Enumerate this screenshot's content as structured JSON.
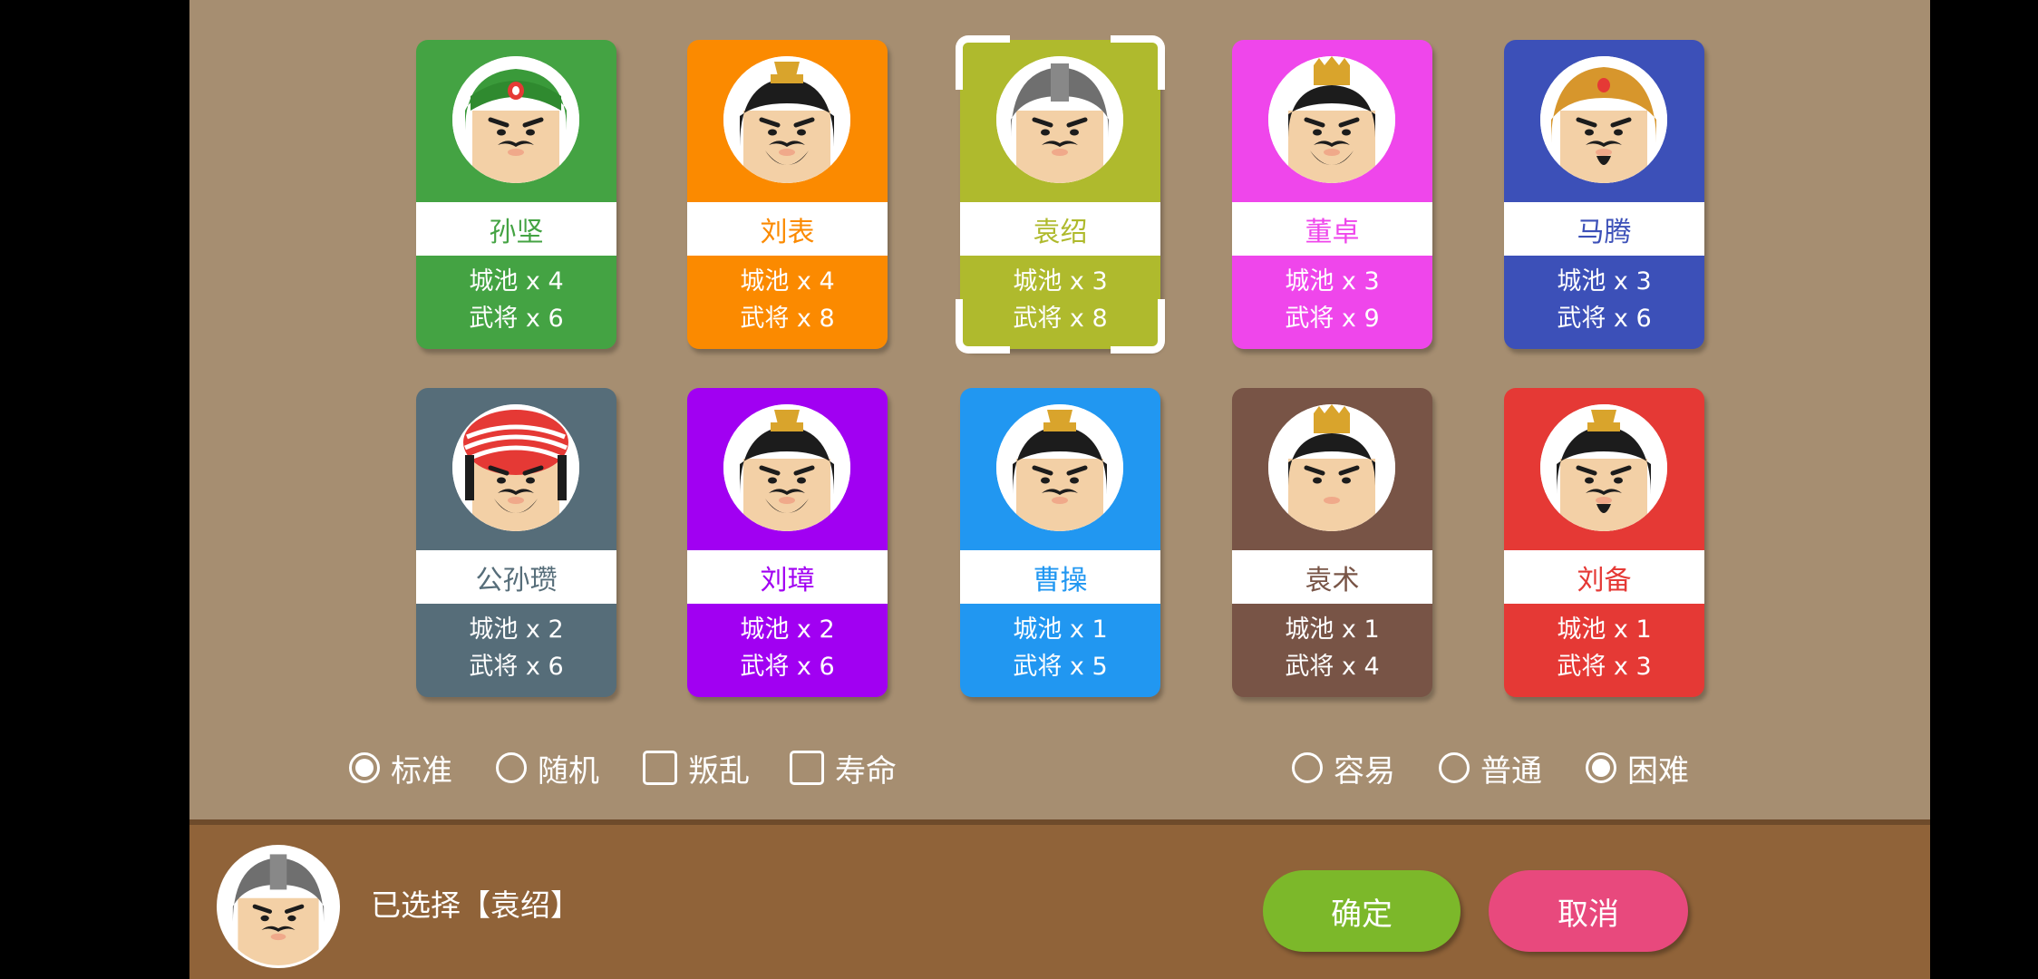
{
  "cards": [
    {
      "name": "孙坚",
      "cities": "城池 x 4",
      "generals": "武将 x 6",
      "color": "#44a343",
      "name_color": "#44a343",
      "icon": "warlord-sun-jian-portrait-icon",
      "headwear": "green-helmet",
      "beard": "mustache"
    },
    {
      "name": "刘表",
      "cities": "城池 x 4",
      "generals": "武将 x 8",
      "color": "#fb8a00",
      "name_color": "#fb8a00",
      "icon": "warlord-liu-biao-portrait-icon",
      "headwear": "black-cap-gold",
      "beard": "full"
    },
    {
      "name": "袁绍",
      "cities": "城池 x 3",
      "generals": "武将 x 8",
      "color": "#afba2d",
      "name_color": "#afba2d",
      "icon": "warlord-yuan-shao-portrait-icon",
      "headwear": "grey-helmet",
      "beard": "mustache"
    },
    {
      "name": "董卓",
      "cities": "城池 x 3",
      "generals": "武将 x 9",
      "color": "#ef46eb",
      "name_color": "#ef46eb",
      "icon": "warlord-dong-zhuo-portrait-icon",
      "headwear": "gold-crown",
      "beard": "full"
    },
    {
      "name": "马腾",
      "cities": "城池 x 3",
      "generals": "武将 x 6",
      "color": "#3c50b8",
      "name_color": "#3c50b8",
      "icon": "warlord-ma-teng-portrait-icon",
      "headwear": "gold-helmet",
      "beard": "goatee"
    },
    {
      "name": "公孙瓒",
      "cities": "城池 x 2",
      "generals": "武将 x 6",
      "color": "#566d79",
      "name_color": "#566d79",
      "icon": "warlord-gongsun-zan-portrait-icon",
      "headwear": "red-turban",
      "beard": "full"
    },
    {
      "name": "刘璋",
      "cities": "城池 x 2",
      "generals": "武将 x 6",
      "color": "#a100f2",
      "name_color": "#a100f2",
      "icon": "warlord-liu-zhang-portrait-icon",
      "headwear": "black-cap-gold",
      "beard": "full"
    },
    {
      "name": "曹操",
      "cities": "城池 x 1",
      "generals": "武将 x 5",
      "color": "#2197f1",
      "name_color": "#2197f1",
      "icon": "warlord-cao-cao-portrait-icon",
      "headwear": "black-cap-gold",
      "beard": "mustache"
    },
    {
      "name": "袁术",
      "cities": "城池 x 1",
      "generals": "武将 x 4",
      "color": "#785446",
      "name_color": "#785446",
      "icon": "warlord-yuan-shu-portrait-icon",
      "headwear": "gold-crown",
      "beard": "none"
    },
    {
      "name": "刘备",
      "cities": "城池 x 1",
      "generals": "武将 x 3",
      "color": "#e53935",
      "name_color": "#e53935",
      "icon": "warlord-liu-bei-portrait-icon",
      "headwear": "black-cap-gold",
      "beard": "goatee"
    }
  ],
  "selected_index": 2,
  "mode_options": [
    {
      "label": "标准",
      "type": "radio",
      "checked": true
    },
    {
      "label": "随机",
      "type": "radio",
      "checked": false
    },
    {
      "label": "叛乱",
      "type": "checkbox",
      "checked": false
    },
    {
      "label": "寿命",
      "type": "checkbox",
      "checked": false
    }
  ],
  "difficulty_options": [
    {
      "label": "容易",
      "checked": false
    },
    {
      "label": "普通",
      "checked": false
    },
    {
      "label": "困难",
      "checked": true
    }
  ],
  "footer": {
    "selected_text": "已选择【袁绍】",
    "avatar_icon": "selected-warlord-portrait-icon",
    "confirm_label": "确定",
    "cancel_label": "取消",
    "confirm_color": "#7cb82a",
    "cancel_color": "#e8497d"
  },
  "colors": {
    "background": "#a68e71",
    "bottom_bar": "#906339"
  }
}
